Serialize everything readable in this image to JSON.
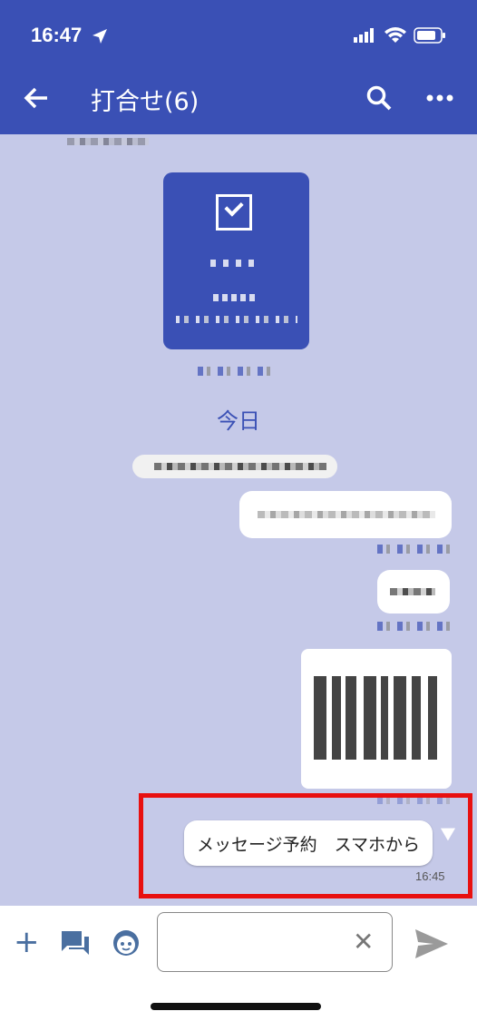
{
  "status_bar": {
    "time": "16:47"
  },
  "nav": {
    "title": "打合せ(6)"
  },
  "chat": {
    "date_separator": "今日",
    "last_message": {
      "text": "メッセージ予約　スマホから",
      "time": "16:45"
    }
  },
  "colors": {
    "header": "#3a50b5",
    "chat_bg": "#c5c9e8",
    "highlight": "#e81010"
  },
  "icons": [
    "location-arrow-icon",
    "signal-icon",
    "wifi-icon",
    "battery-icon",
    "back-arrow-icon",
    "search-icon",
    "more-icon",
    "plus-icon",
    "chat-icon",
    "emoji-icon",
    "clear-icon",
    "send-icon",
    "checkbox-icon"
  ]
}
